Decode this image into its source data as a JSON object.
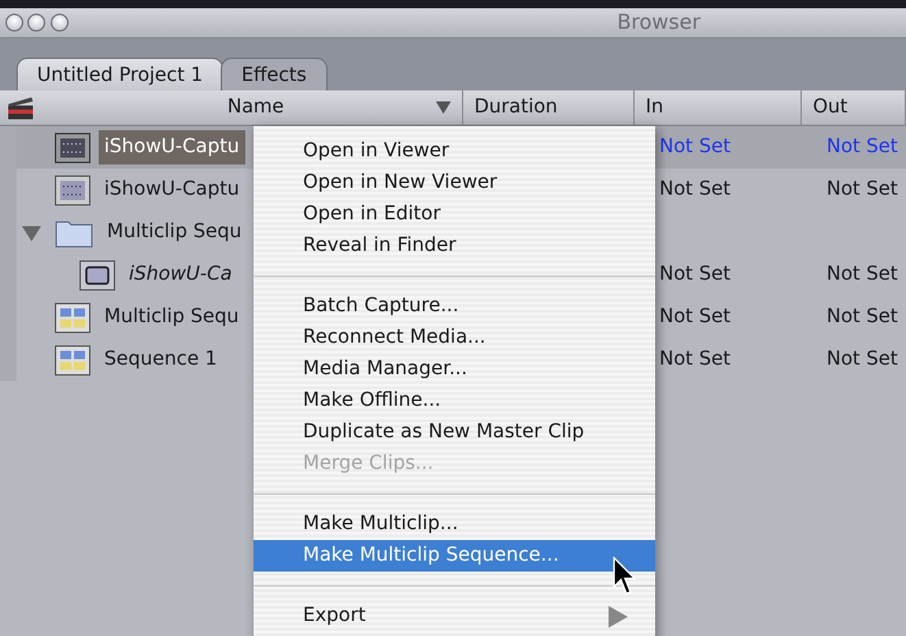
{
  "window": {
    "title": "Browser"
  },
  "tabs": [
    {
      "label": "Untitled Project 1",
      "selected": true
    },
    {
      "label": "Effects",
      "selected": false
    }
  ],
  "columns": [
    {
      "label": "Name",
      "sort_arrow": true
    },
    {
      "label": "Duration"
    },
    {
      "label": "In"
    },
    {
      "label": "Out"
    }
  ],
  "rows": [
    {
      "kind": "clip",
      "name": "iShowU-Captu",
      "selected": true,
      "in": "Not Set",
      "out": "Not Set"
    },
    {
      "kind": "clip",
      "name": "iShowU-Captu",
      "selected": false,
      "in": "Not Set",
      "out": "Not Set"
    },
    {
      "kind": "folder",
      "name": "Multiclip Sequ",
      "selected": false,
      "expanded": true,
      "children": [
        {
          "kind": "multiclip",
          "name": "iShowU-Ca",
          "selected": false,
          "in": "Not Set",
          "out": "Not Set"
        }
      ]
    },
    {
      "kind": "sequence",
      "name": "Multiclip Sequ",
      "selected": false,
      "in": "Not Set",
      "out": "Not Set"
    },
    {
      "kind": "sequence",
      "name": "Sequence 1",
      "selected": false,
      "in": "Not Set",
      "out": "Not Set"
    }
  ],
  "context_menu": [
    {
      "kind": "item",
      "label": "Open in Viewer",
      "disabled": false,
      "selected": false
    },
    {
      "kind": "item",
      "label": "Open in New Viewer",
      "disabled": false,
      "selected": false
    },
    {
      "kind": "item",
      "label": "Open in Editor",
      "disabled": false,
      "selected": false
    },
    {
      "kind": "item",
      "label": "Reveal in Finder",
      "disabled": false,
      "selected": false
    },
    {
      "kind": "separator"
    },
    {
      "kind": "item",
      "label": "Batch Capture...",
      "disabled": false,
      "selected": false
    },
    {
      "kind": "item",
      "label": "Reconnect Media...",
      "disabled": false,
      "selected": false
    },
    {
      "kind": "item",
      "label": "Media Manager...",
      "disabled": false,
      "selected": false
    },
    {
      "kind": "item",
      "label": "Make Offline...",
      "disabled": false,
      "selected": false
    },
    {
      "kind": "item",
      "label": "Duplicate as New Master Clip",
      "disabled": false,
      "selected": false
    },
    {
      "kind": "item",
      "label": "Merge Clips...",
      "disabled": true,
      "selected": false
    },
    {
      "kind": "separator"
    },
    {
      "kind": "item",
      "label": "Make Multiclip...",
      "disabled": false,
      "selected": false
    },
    {
      "kind": "item",
      "label": "Make Multiclip Sequence...",
      "disabled": false,
      "selected": true
    },
    {
      "kind": "separator"
    },
    {
      "kind": "submenu",
      "label": "Export",
      "disabled": false,
      "selected": false
    }
  ]
}
